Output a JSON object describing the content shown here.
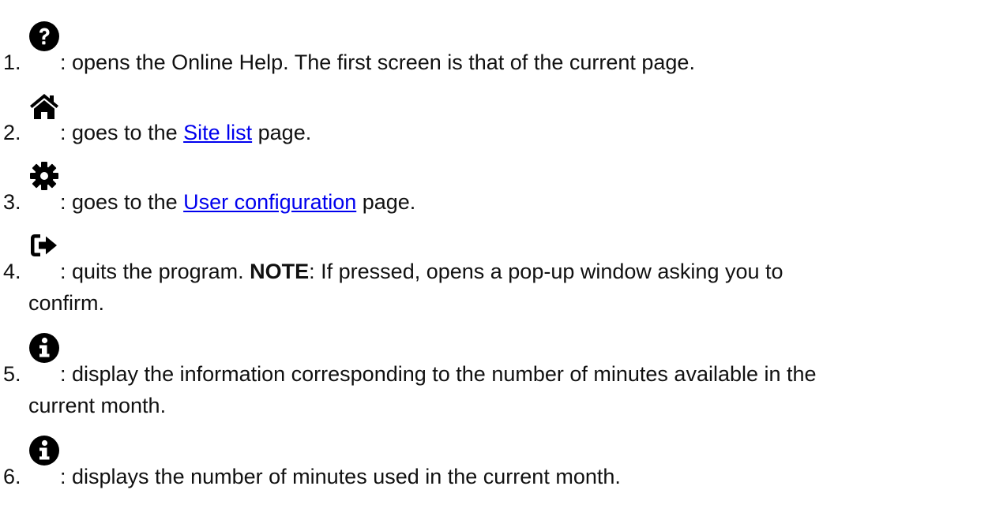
{
  "items": [
    {
      "number": "1.",
      "icon": "question-circle-icon",
      "text": ": opens the Online Help. The first screen is that of the current page."
    },
    {
      "number": "2.",
      "icon": "home-icon",
      "text_before": ": goes to the ",
      "link": "Site list",
      "text_after": " page."
    },
    {
      "number": "3.",
      "icon": "gear-icon",
      "text_before": ": goes to the ",
      "link": "User configuration",
      "text_after": " page."
    },
    {
      "number": "4.",
      "icon": "sign-out-icon",
      "text_before": ": quits the program. ",
      "bold": "NOTE",
      "text_after": ": If pressed, opens a pop-up window asking you to",
      "continuation": "confirm."
    },
    {
      "number": "5.",
      "icon": "info-circle-icon",
      "text": ": display the information corresponding to the number of minutes available in the",
      "continuation": "current month."
    },
    {
      "number": "6.",
      "icon": "info-circle-icon",
      "text": ": displays the number of minutes used in the current month."
    }
  ]
}
